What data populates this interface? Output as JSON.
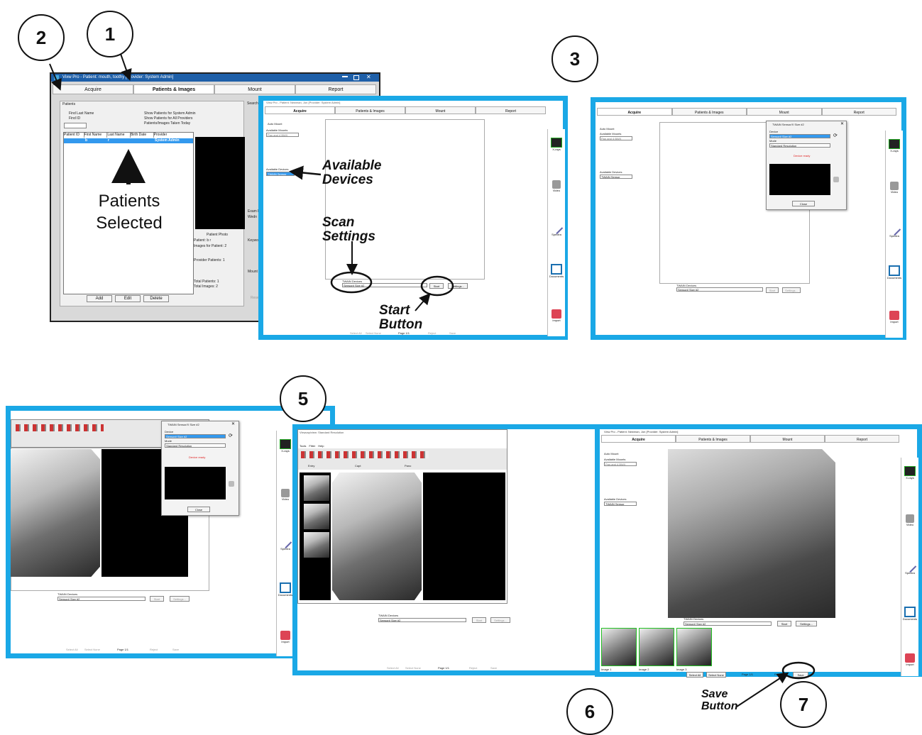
{
  "steps": {
    "s1": "1",
    "s2": "2",
    "s3": "3",
    "s5": "5",
    "s6": "6",
    "s7": "7"
  },
  "callouts": {
    "patients_selected": "Patients\nSelected",
    "available_devices": "Available\nDevices",
    "scan_settings": "Scan\nSettings",
    "start_button": "Start\nButton",
    "save_button": "Save\nButton"
  },
  "vixwin": {
    "title": "Vixw Pro -   Patient: mouth, toothy [Provider: System Admin]",
    "tabs": [
      "Acquire",
      "Patients & Images",
      "Mount",
      "Report"
    ],
    "patients_group": "Patients",
    "search_group": "Search",
    "find_last_name": "Find Last Name",
    "find_id": "Find ID",
    "show_sys_admin": "Show Patients for System Admin",
    "show_all": "Show Patients for All Providers",
    "taken_today": "Patients/Images Taken Today",
    "columns": [
      "Patient ID",
      "First Name",
      "Last Name",
      "Birth Date",
      "Provider"
    ],
    "row": {
      "first": "b",
      "last": "r",
      "provider": "System Admin"
    },
    "patient_photo": "Patient Photo",
    "patient": "Patient: b r",
    "images_for": "Images for Patient: 2",
    "provider_patients": "Provider Patients: 1",
    "total_patients": "Total Patients: 1",
    "total_images": "Total Images: 2",
    "add": "Add",
    "edit": "Edit",
    "delete": "Delete",
    "exam": "Exam D",
    "keyw": "Keywo",
    "mount": "Mount",
    "right_wed": "Wedn",
    "reset": "Reset"
  },
  "acquire": {
    "title": "Vixw Pro - Patient: Newman, Jon [Provider: System Admin]",
    "tabs": [
      "Acquire",
      "Patients & Images",
      "Mount",
      "Report"
    ],
    "auto_mount": "Auto Mount",
    "available_mounts": "Available Mounts",
    "mount_value": "Pan and 4 BWX",
    "available_devices": "Available Devices",
    "device_value": "TWAIN Sensor",
    "twain_devices": "TWAIN Devices",
    "twain_value": "Sensor# Size #2",
    "start": "Start",
    "settings": "Settings...",
    "select_all": "Select All",
    "select_none": "Select None",
    "page": "Page 1/1",
    "reject": "Reject",
    "save": "Save",
    "side": [
      "X-rays",
      "Video",
      "Spectra",
      "Documents",
      "Import"
    ]
  },
  "twain_dialog": {
    "title": "TWAIN Sensor/X Size #2",
    "device_label": "Device",
    "device_value": "Sensor# Size #2",
    "mode_label": "Mode",
    "mode_value": "Standard Resolution",
    "status": "Device ready",
    "close": "Close"
  },
  "capture": {
    "title": "Vixwcap/view: Standard Resolution",
    "menu": [
      "Tools",
      "Filter",
      "Help"
    ],
    "groups": [
      "Entry",
      "Capt",
      "Pano"
    ]
  },
  "thumbs": [
    "Image 1",
    "Image 2",
    "Image 3"
  ],
  "colors": {
    "frame": "#1aa8e6",
    "green": "#22c022",
    "status": "#e02020"
  }
}
